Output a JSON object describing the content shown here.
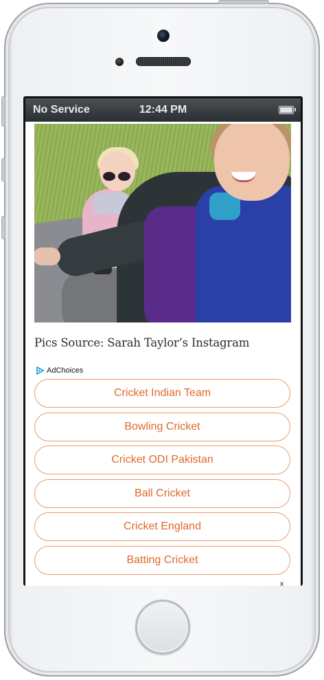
{
  "status_bar": {
    "carrier": "No Service",
    "time": "12:44 PM"
  },
  "article": {
    "photo_caption": "Pics Source: Sarah Taylor’s Instagram"
  },
  "ad": {
    "adchoices_label": "AdChoices",
    "links": [
      {
        "label": "Cricket Indian Team"
      },
      {
        "label": "Bowling Cricket"
      },
      {
        "label": "Cricket ODI Pakistan"
      },
      {
        "label": "Ball Cricket"
      },
      {
        "label": "Cricket England"
      },
      {
        "label": "Batting Cricket"
      }
    ],
    "close_label": "x"
  },
  "colors": {
    "link_text": "#e0682a",
    "link_border": "#e89a6a",
    "adchoices_blue": "#1aa0d8"
  }
}
